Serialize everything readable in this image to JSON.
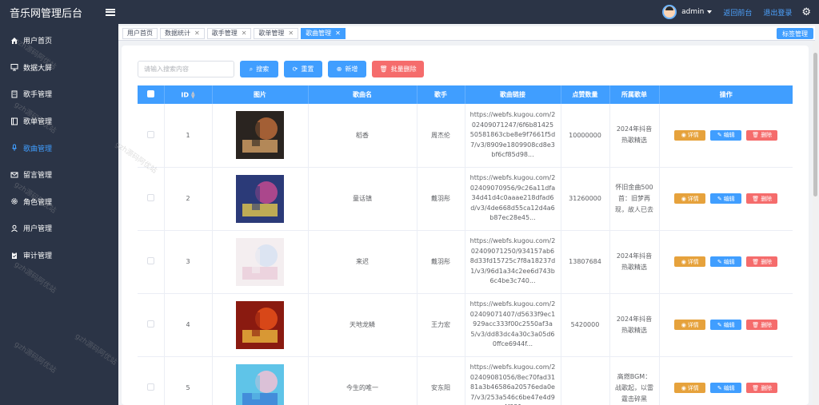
{
  "header": {
    "title": "音乐网管理后台",
    "username": "admin",
    "back_link": "返回前台",
    "logout_link": "退出登录"
  },
  "sidebar": {
    "items": [
      {
        "label": "用户首页",
        "icon": "home-icon"
      },
      {
        "label": "数据大屏",
        "icon": "monitor-icon"
      },
      {
        "label": "歌手管理",
        "icon": "building-icon"
      },
      {
        "label": "歌单管理",
        "icon": "book-icon"
      },
      {
        "label": "歌曲管理",
        "icon": "microphone-icon",
        "active": true
      },
      {
        "label": "留言管理",
        "icon": "mail-icon"
      },
      {
        "label": "角色管理",
        "icon": "gear-icon"
      },
      {
        "label": "用户管理",
        "icon": "user-icon"
      },
      {
        "label": "审计管理",
        "icon": "clipboard-icon"
      }
    ]
  },
  "tabs": [
    {
      "label": "用户首页",
      "active": false
    },
    {
      "label": "数据统计",
      "active": false
    },
    {
      "label": "歌手管理",
      "active": false
    },
    {
      "label": "歌单管理",
      "active": false
    },
    {
      "label": "歌曲管理",
      "active": true
    }
  ],
  "tags_button": "标签管理",
  "filters": {
    "search_placeholder": "请输入搜索内容",
    "search_button": "搜索",
    "reset_button": "重置",
    "add_button": "新增",
    "batch_delete_button": "批量删除"
  },
  "table": {
    "columns": [
      "ID",
      "图片",
      "歌曲名",
      "歌手",
      "歌曲链接",
      "点赞数量",
      "所属歌单",
      "操作"
    ],
    "rows": [
      {
        "id": "1",
        "name": "稻香",
        "singer": "周杰伦",
        "link": "https://webfs.kugou.com/202409071247/6f6b8142550581863cbe8e9f7661f5d7/v3/8909e1809908cd8e3bf6cf85d98...",
        "likes": "10000000",
        "playlist": "2024年抖音热歌精选",
        "cover_colors": [
          "#2a2420",
          "#b86a3a",
          "#e2a96b"
        ]
      },
      {
        "id": "2",
        "name": "童话镇",
        "singer": "戴羽彤",
        "link": "https://webfs.kugou.com/202409070956/9c26a11dfa34d41d4c0aaae218dfad6d/v3/4de668d55ca12d4a6b87ec28e45...",
        "likes": "31260000",
        "playlist": "怀旧金曲500首：旧梦再现，故人已去",
        "cover_colors": [
          "#2b3a78",
          "#c24a8f",
          "#f0d24a"
        ]
      },
      {
        "id": "3",
        "name": "来迟",
        "singer": "戴羽彤",
        "link": "https://webfs.kugou.com/202409071250/934157ab68d33fd15725c7f8a18237d1/v3/96d1a34c2ee6d743b6c4be3c740...",
        "likes": "13807684",
        "playlist": "2024年抖音热歌精选",
        "cover_colors": [
          "#f4eef0",
          "#d7e2f2",
          "#e9c9d8"
        ]
      },
      {
        "id": "4",
        "name": "天地龙鳞",
        "singer": "王力宏",
        "link": "https://webfs.kugou.com/202409071407/d5633f9ec1929acc333f00c2550af3a5/v3/dd83dc4a30c3a05d60ffce6944f...",
        "likes": "5420000",
        "playlist": "2024年抖音热歌精选",
        "cover_colors": [
          "#8a1a10",
          "#e5501a",
          "#f2c340"
        ]
      },
      {
        "id": "5",
        "name": "今生的唯一",
        "singer": "安东阳",
        "link": "https://webfs.kugou.com/202409081056/8ec70fad3181a3b46586a20576eda0e7/v3/253a546c6be47e4d94f921",
        "likes": "",
        "playlist": "高燃BGM：战歌起，以雷霆击碎黑",
        "cover_colors": [
          "#5fc4e8",
          "#f1c1d4",
          "#3a7bd5"
        ]
      }
    ],
    "actions": {
      "detail": "详情",
      "edit": "编辑",
      "delete": "删除"
    }
  },
  "colors": {
    "sidebar_bg": "#2b3446",
    "primary": "#409eff",
    "danger": "#f56c6c",
    "warning": "#e6a23c"
  }
}
